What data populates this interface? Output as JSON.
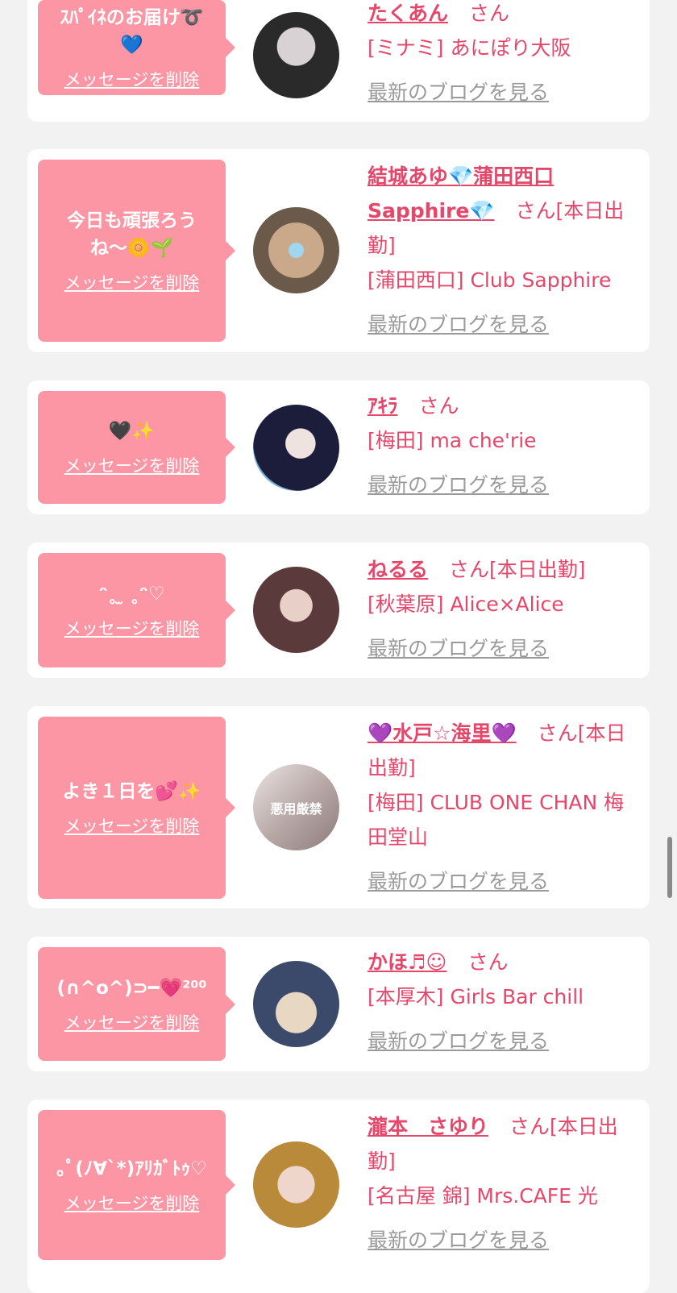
{
  "messages": [
    {
      "message": "ｽﾊﾟｲﾈのお届け➰💙",
      "delete_label": "メッセージを削除",
      "name": "たくあん",
      "san": "さん",
      "status": "",
      "shop": "[ミナミ] あにぽり大阪",
      "blog_label": "最新のブログを見る",
      "avatar_colors": [
        "#2a2a2a",
        "#d9d2d4"
      ]
    },
    {
      "message": "今日も頑張ろうね〜🌼🌱",
      "delete_label": "メッセージを削除",
      "name": "結城あゆ💎蒲田西口Sapphire💎",
      "san": "さん",
      "status": "[本日出勤]",
      "shop": "[蒲田西口] Club Sapphire",
      "blog_label": "最新のブログを見る",
      "avatar_colors": [
        "#c9a98a",
        "#6b5a4a"
      ]
    },
    {
      "message": "🖤✨",
      "delete_label": "メッセージを削除",
      "name": "ｱｷﾗ",
      "san": "さん",
      "status": "",
      "shop": "[梅田] ma che'rie",
      "blog_label": "最新のブログを見る",
      "avatar_colors": [
        "#1b1d3a",
        "#7fb6d6"
      ]
    },
    {
      "message": "ᵔ˳ ̫ ˳ᵔ♡",
      "delete_label": "メッセージを削除",
      "name": "ねるる",
      "san": "さん",
      "status": "[本日出勤]",
      "shop": "[秋葉原] Alice×Alice",
      "blog_label": "最新のブログを見る",
      "avatar_colors": [
        "#5a3a3a",
        "#e8cfc8"
      ]
    },
    {
      "message": "よき１日を💕✨",
      "delete_label": "メッセージを削除",
      "name": "💜水戸☆海里💜",
      "san": "さん",
      "status": "[本日出勤]",
      "shop": "[梅田] CLUB ONE CHAN 梅田堂山",
      "blog_label": "最新のブログを見る",
      "avatar_colors": [
        "#e9e3e3",
        "#8c7a7a"
      ],
      "avatar_overlay": "悪用厳禁"
    },
    {
      "message": "(∩^o^)⊃━💗²⁰⁰",
      "delete_label": "メッセージを削除",
      "name": "かほ♬☺︎",
      "san": "さん",
      "status": "",
      "shop": "[本厚木] Girls Bar chill",
      "blog_label": "最新のブログを見る",
      "avatar_colors": [
        "#3b4a6a",
        "#e7d7c3"
      ]
    },
    {
      "message": "｡ﾟ(ﾉ∀`*)ｱﾘｶﾞﾄｩ♡",
      "delete_label": "メッセージを削除",
      "name": "瀧本　さゆり",
      "san": "さん",
      "status": "[本日出勤]",
      "shop": "[名古屋 錦] Mrs.CAFE 光",
      "blog_label": "最新のブログを見る",
      "avatar_colors": [
        "#b98a3a",
        "#efd6cc"
      ]
    }
  ],
  "colors": {
    "page_bg": "#f2f2f2",
    "card_bg": "#ffffff",
    "bubble_bg": "#fc96a4",
    "accent_text": "#e5476b",
    "muted_link": "#9a9a9a"
  }
}
